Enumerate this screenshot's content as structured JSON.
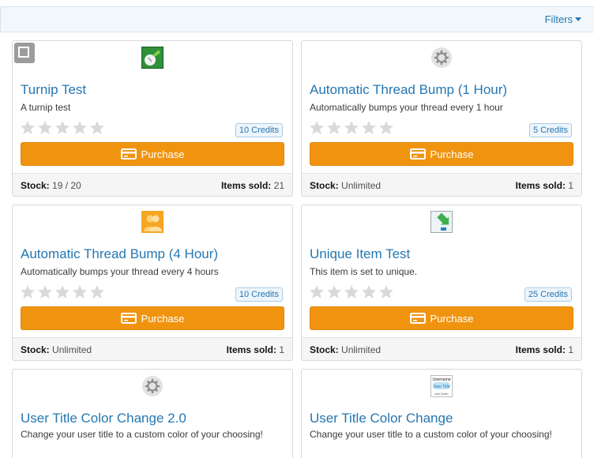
{
  "header": {
    "filters_label": "Filters"
  },
  "purchase_label": "Purchase",
  "labels": {
    "stock": "Stock:",
    "items_sold": "Items sold:"
  },
  "items": [
    {
      "title": "Turnip Test",
      "description": "A turnip test",
      "credits": "10 Credits",
      "stock": "19 / 20",
      "items_sold": "21",
      "icon": "turnip-icon"
    },
    {
      "title": "Automatic Thread Bump (1 Hour)",
      "description": "Automatically bumps your thread every 1 hour",
      "credits": "5 Credits",
      "stock": "Unlimited",
      "items_sold": "1",
      "icon": "gear-icon"
    },
    {
      "title": "Automatic Thread Bump (4 Hour)",
      "description": "Automatically bumps your thread every 4 hours",
      "credits": "10 Credits",
      "stock": "Unlimited",
      "items_sold": "1",
      "icon": "users-icon"
    },
    {
      "title": "Unique Item Test",
      "description": "This item is set to unique.",
      "credits": "25 Credits",
      "stock": "Unlimited",
      "items_sold": "1",
      "icon": "unique-arrow-icon"
    },
    {
      "title": "User Title Color Change 2.0",
      "description": "Change your user title to a custom color of your choosing!",
      "icon": "gear-icon"
    },
    {
      "title": "User Title Color Change",
      "description": "Change your user title to a custom color of your choosing!",
      "icon": "user-title-icon"
    }
  ],
  "user_title_icon_text": {
    "line1": "Username",
    "line2": "User Title",
    "line3": "Join Date:"
  },
  "colors": {
    "accent": "#2577b1",
    "purchase": "#f09410",
    "star": "#d9d9d9"
  }
}
